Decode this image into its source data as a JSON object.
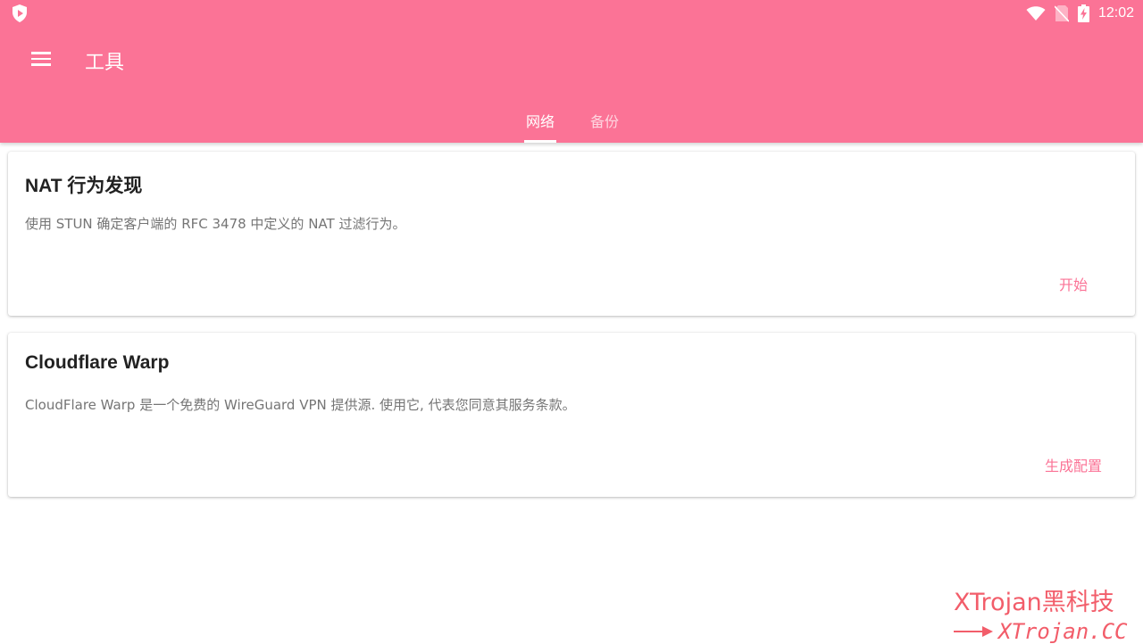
{
  "status_bar": {
    "time": "12:02",
    "icons": [
      "shield-icon",
      "wifi-icon",
      "no-sim-icon",
      "battery-charging-icon"
    ]
  },
  "toolbar": {
    "title": "工具",
    "menu_icon": "menu-icon"
  },
  "tabs": [
    {
      "label": "网络",
      "active": true
    },
    {
      "label": "备份",
      "active": false
    }
  ],
  "cards": [
    {
      "title": "NAT 行为发现",
      "description": "使用 STUN 确定客户端的 RFC 3478 中定义的 NAT 过滤行为。",
      "action": "开始"
    },
    {
      "title": "Cloudflare Warp",
      "description": "CloudFlare Warp 是一个免费的 WireGuard VPN 提供源. 使用它, 代表您同意其服务条款。",
      "action": "生成配置"
    }
  ],
  "watermark": {
    "line1": "XTrojan黑科技",
    "line2": "XTrojan.CC"
  },
  "colors": {
    "primary": "#fb7396",
    "watermark": "#f25d6a"
  }
}
